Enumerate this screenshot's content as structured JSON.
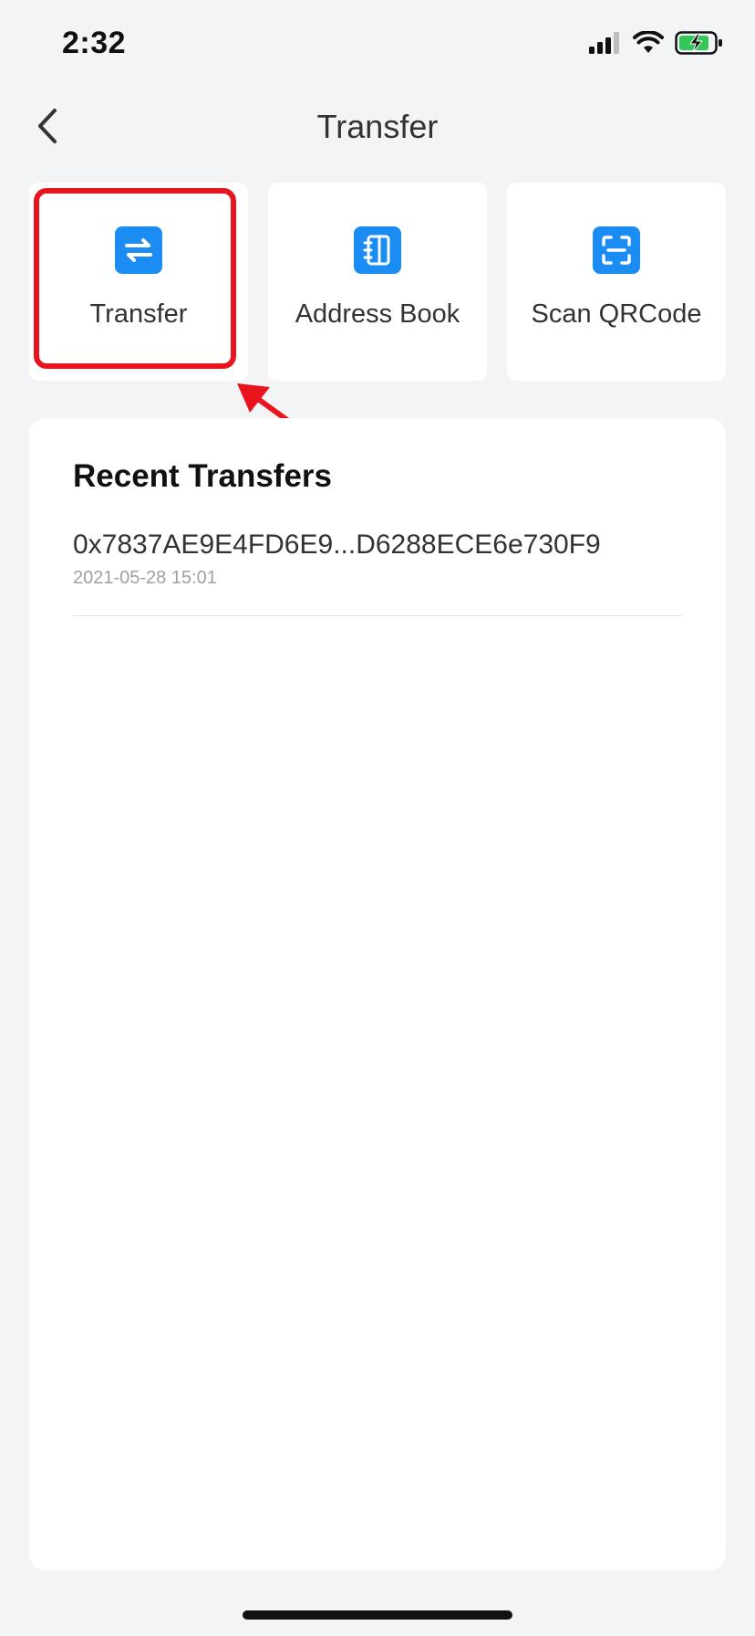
{
  "status_bar": {
    "time": "2:32",
    "icons": [
      "signal-icon",
      "wifi-icon",
      "battery-charging-icon"
    ],
    "battery_color": "#34c759"
  },
  "nav": {
    "title": "Transfer",
    "back_icon": "chevron-left-icon"
  },
  "actions": [
    {
      "label": "Transfer",
      "icon": "transfer-arrows-icon",
      "highlighted": true
    },
    {
      "label": "Address Book",
      "icon": "address-book-icon",
      "highlighted": false
    },
    {
      "label": "Scan QRCode",
      "icon": "scan-qr-icon",
      "highlighted": false
    }
  ],
  "recent": {
    "title": "Recent Transfers",
    "items": [
      {
        "address": "0x7837AE9E4FD6E9...D6288ECE6e730F9",
        "date": "2021-05-28 15:01"
      }
    ]
  },
  "colors": {
    "accent": "#1a8cf2",
    "highlight": "#e8141e",
    "background": "#f3f4f6"
  }
}
